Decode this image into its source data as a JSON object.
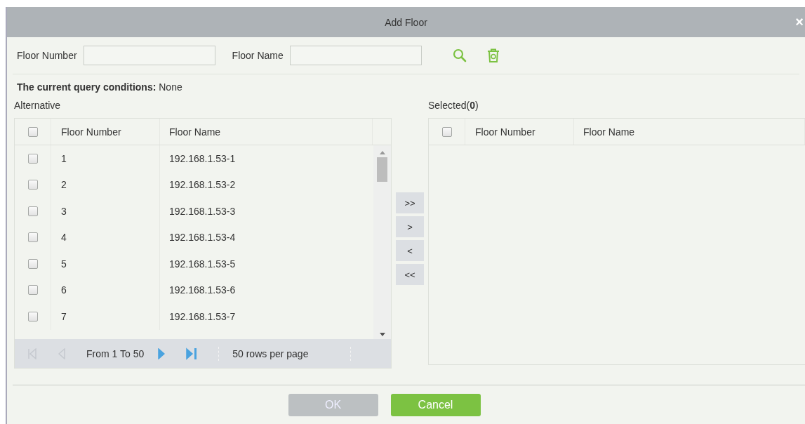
{
  "window": {
    "title": "Add Floor",
    "close": "×"
  },
  "search": {
    "fields": [
      {
        "label": "Floor Number"
      },
      {
        "label": "Floor Name"
      }
    ]
  },
  "query_conditions": {
    "label": "The current query conditions:",
    "value": "None"
  },
  "alternative": {
    "title": "Alternative",
    "header_checked": false,
    "columns": [
      "Floor Number",
      "Floor Name"
    ],
    "rows": [
      {
        "number": "1",
        "name": "192.168.1.53-1",
        "checked": false
      },
      {
        "number": "2",
        "name": "192.168.1.53-2",
        "checked": false
      },
      {
        "number": "3",
        "name": "192.168.1.53-3",
        "checked": false
      },
      {
        "number": "4",
        "name": "192.168.1.53-4",
        "checked": false
      },
      {
        "number": "5",
        "name": "192.168.1.53-5",
        "checked": false
      },
      {
        "number": "6",
        "name": "192.168.1.53-6",
        "checked": false
      },
      {
        "number": "7",
        "name": "192.168.1.53-7",
        "checked": false
      }
    ],
    "pager": {
      "first_disabled": true,
      "prev_disabled": true,
      "next_disabled": false,
      "last_disabled": false,
      "range": "From 1 To 50",
      "per_page": "50 rows per page"
    }
  },
  "transfer_buttons": [
    ">>",
    ">",
    "<",
    "<<"
  ],
  "selected": {
    "title": "Selected(**0**)",
    "header_checked": false,
    "columns": [
      "Floor Number",
      "Floor Name"
    ]
  },
  "buttons": [
    {
      "label": "OK",
      "disabled": true
    },
    {
      "label": "Cancel",
      "disabled": false
    }
  ]
}
